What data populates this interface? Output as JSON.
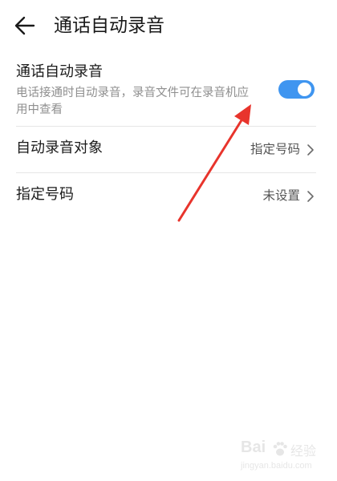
{
  "header": {
    "back_icon": "arrow-left-icon",
    "title": "通话自动录音"
  },
  "settings": {
    "auto_record": {
      "title": "通话自动录音",
      "description": "电话接通时自动录音，录音文件可在录音机应用中查看",
      "enabled": true
    },
    "record_target": {
      "label": "自动录音对象",
      "value": "指定号码",
      "icon": "chevron-right-icon"
    },
    "specified_numbers": {
      "label": "指定号码",
      "value": "未设置",
      "icon": "chevron-right-icon"
    }
  },
  "annotation": {
    "icon": "red-arrow-icon",
    "color": "#e8342c"
  },
  "watermark": {
    "brand": "Bai",
    "label": "经验",
    "url": "jingyan.baidu.com"
  },
  "colors": {
    "accent": "#3f95f0",
    "secondary_text": "#8f8f8f"
  }
}
